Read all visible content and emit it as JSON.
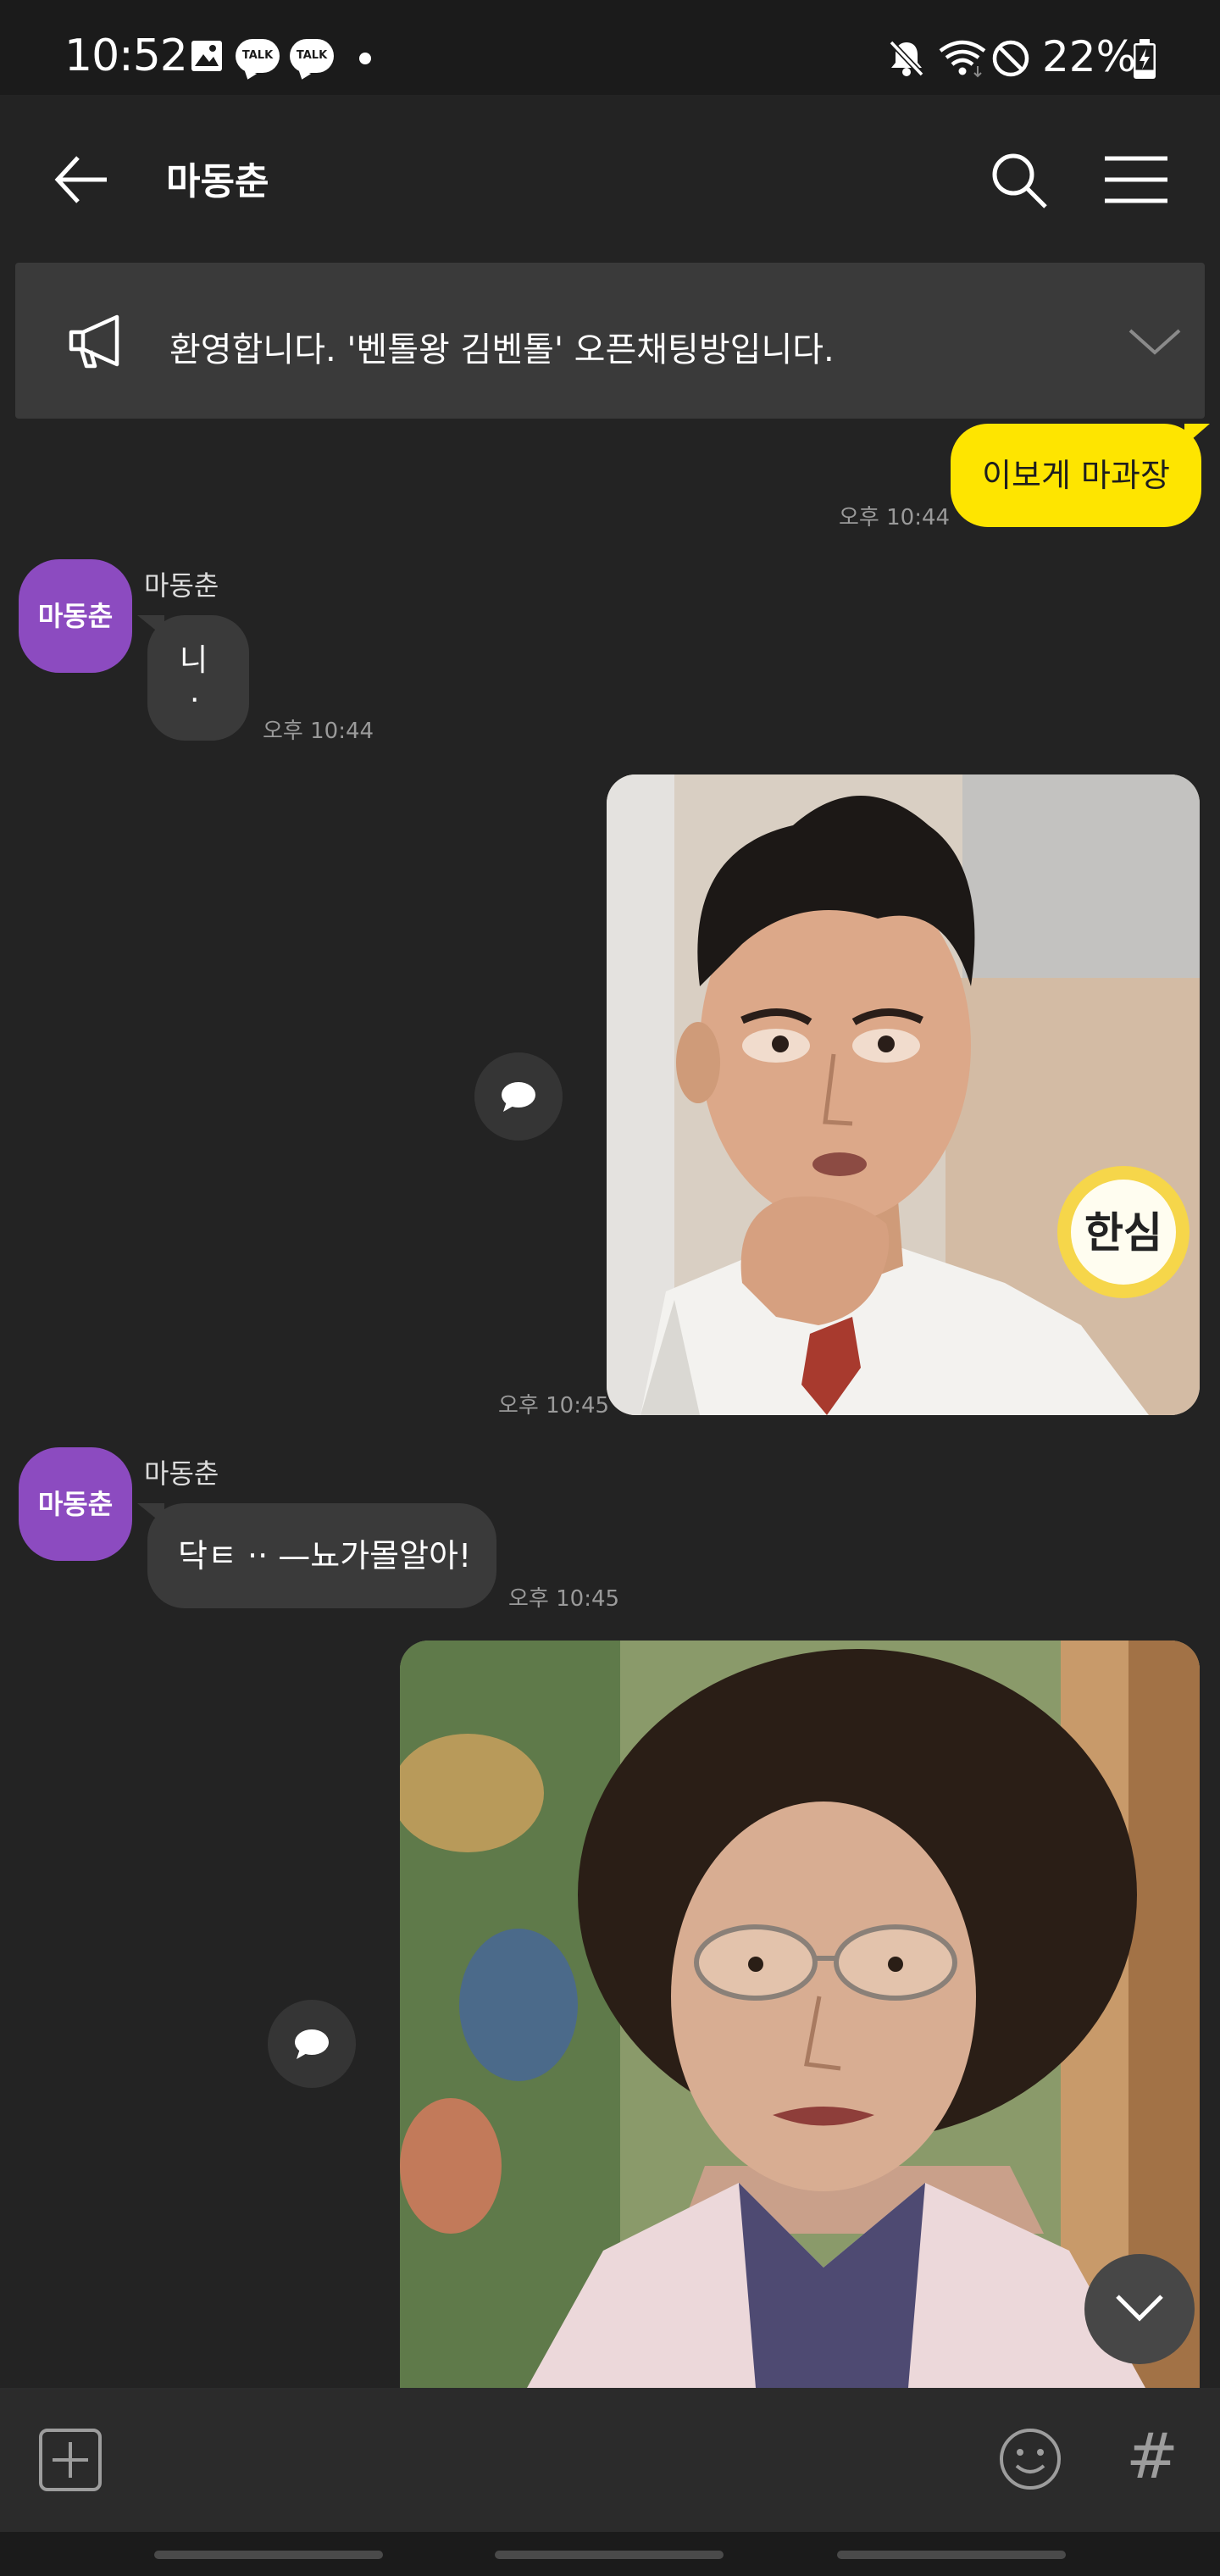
{
  "status_bar": {
    "time": "10:52",
    "talk_badge_1": "TALK",
    "talk_badge_2": "TALK",
    "battery": "22%"
  },
  "header": {
    "title": "마동춘"
  },
  "notice": {
    "text": "환영합니다. '벤톨왕 김벤톨' 오픈채팅방입니다."
  },
  "messages": [
    {
      "from": "me",
      "text": "이보게 마과장",
      "time": "오후 10:44"
    },
    {
      "from": "other",
      "sender": "마동춘",
      "avatar": "마동춘",
      "text_line1": "니",
      "text_line2": ".",
      "time": "오후 10:44"
    },
    {
      "from": "me",
      "type": "photo",
      "time": "오후 10:45",
      "photo_caption": "한심"
    },
    {
      "from": "other",
      "sender": "마동춘",
      "avatar": "마동춘",
      "text": "닥ㅌ ·· —뇨가몰알아!",
      "time": "오후 10:45"
    },
    {
      "from": "me",
      "type": "photo"
    }
  ],
  "icons": {
    "back": "arrow-left-icon",
    "search": "search-icon",
    "menu": "hamburger-icon",
    "notice": "megaphone-icon",
    "expand": "chevron-down-icon",
    "share": "speech-bubble-icon",
    "plus": "plus-square-icon",
    "emoji": "smiley-icon",
    "hash": "#"
  },
  "colors": {
    "bg": "#232323",
    "my_bubble": "#fee500",
    "other_bubble": "#3a3a3a",
    "avatar": "#8c4bc0"
  }
}
